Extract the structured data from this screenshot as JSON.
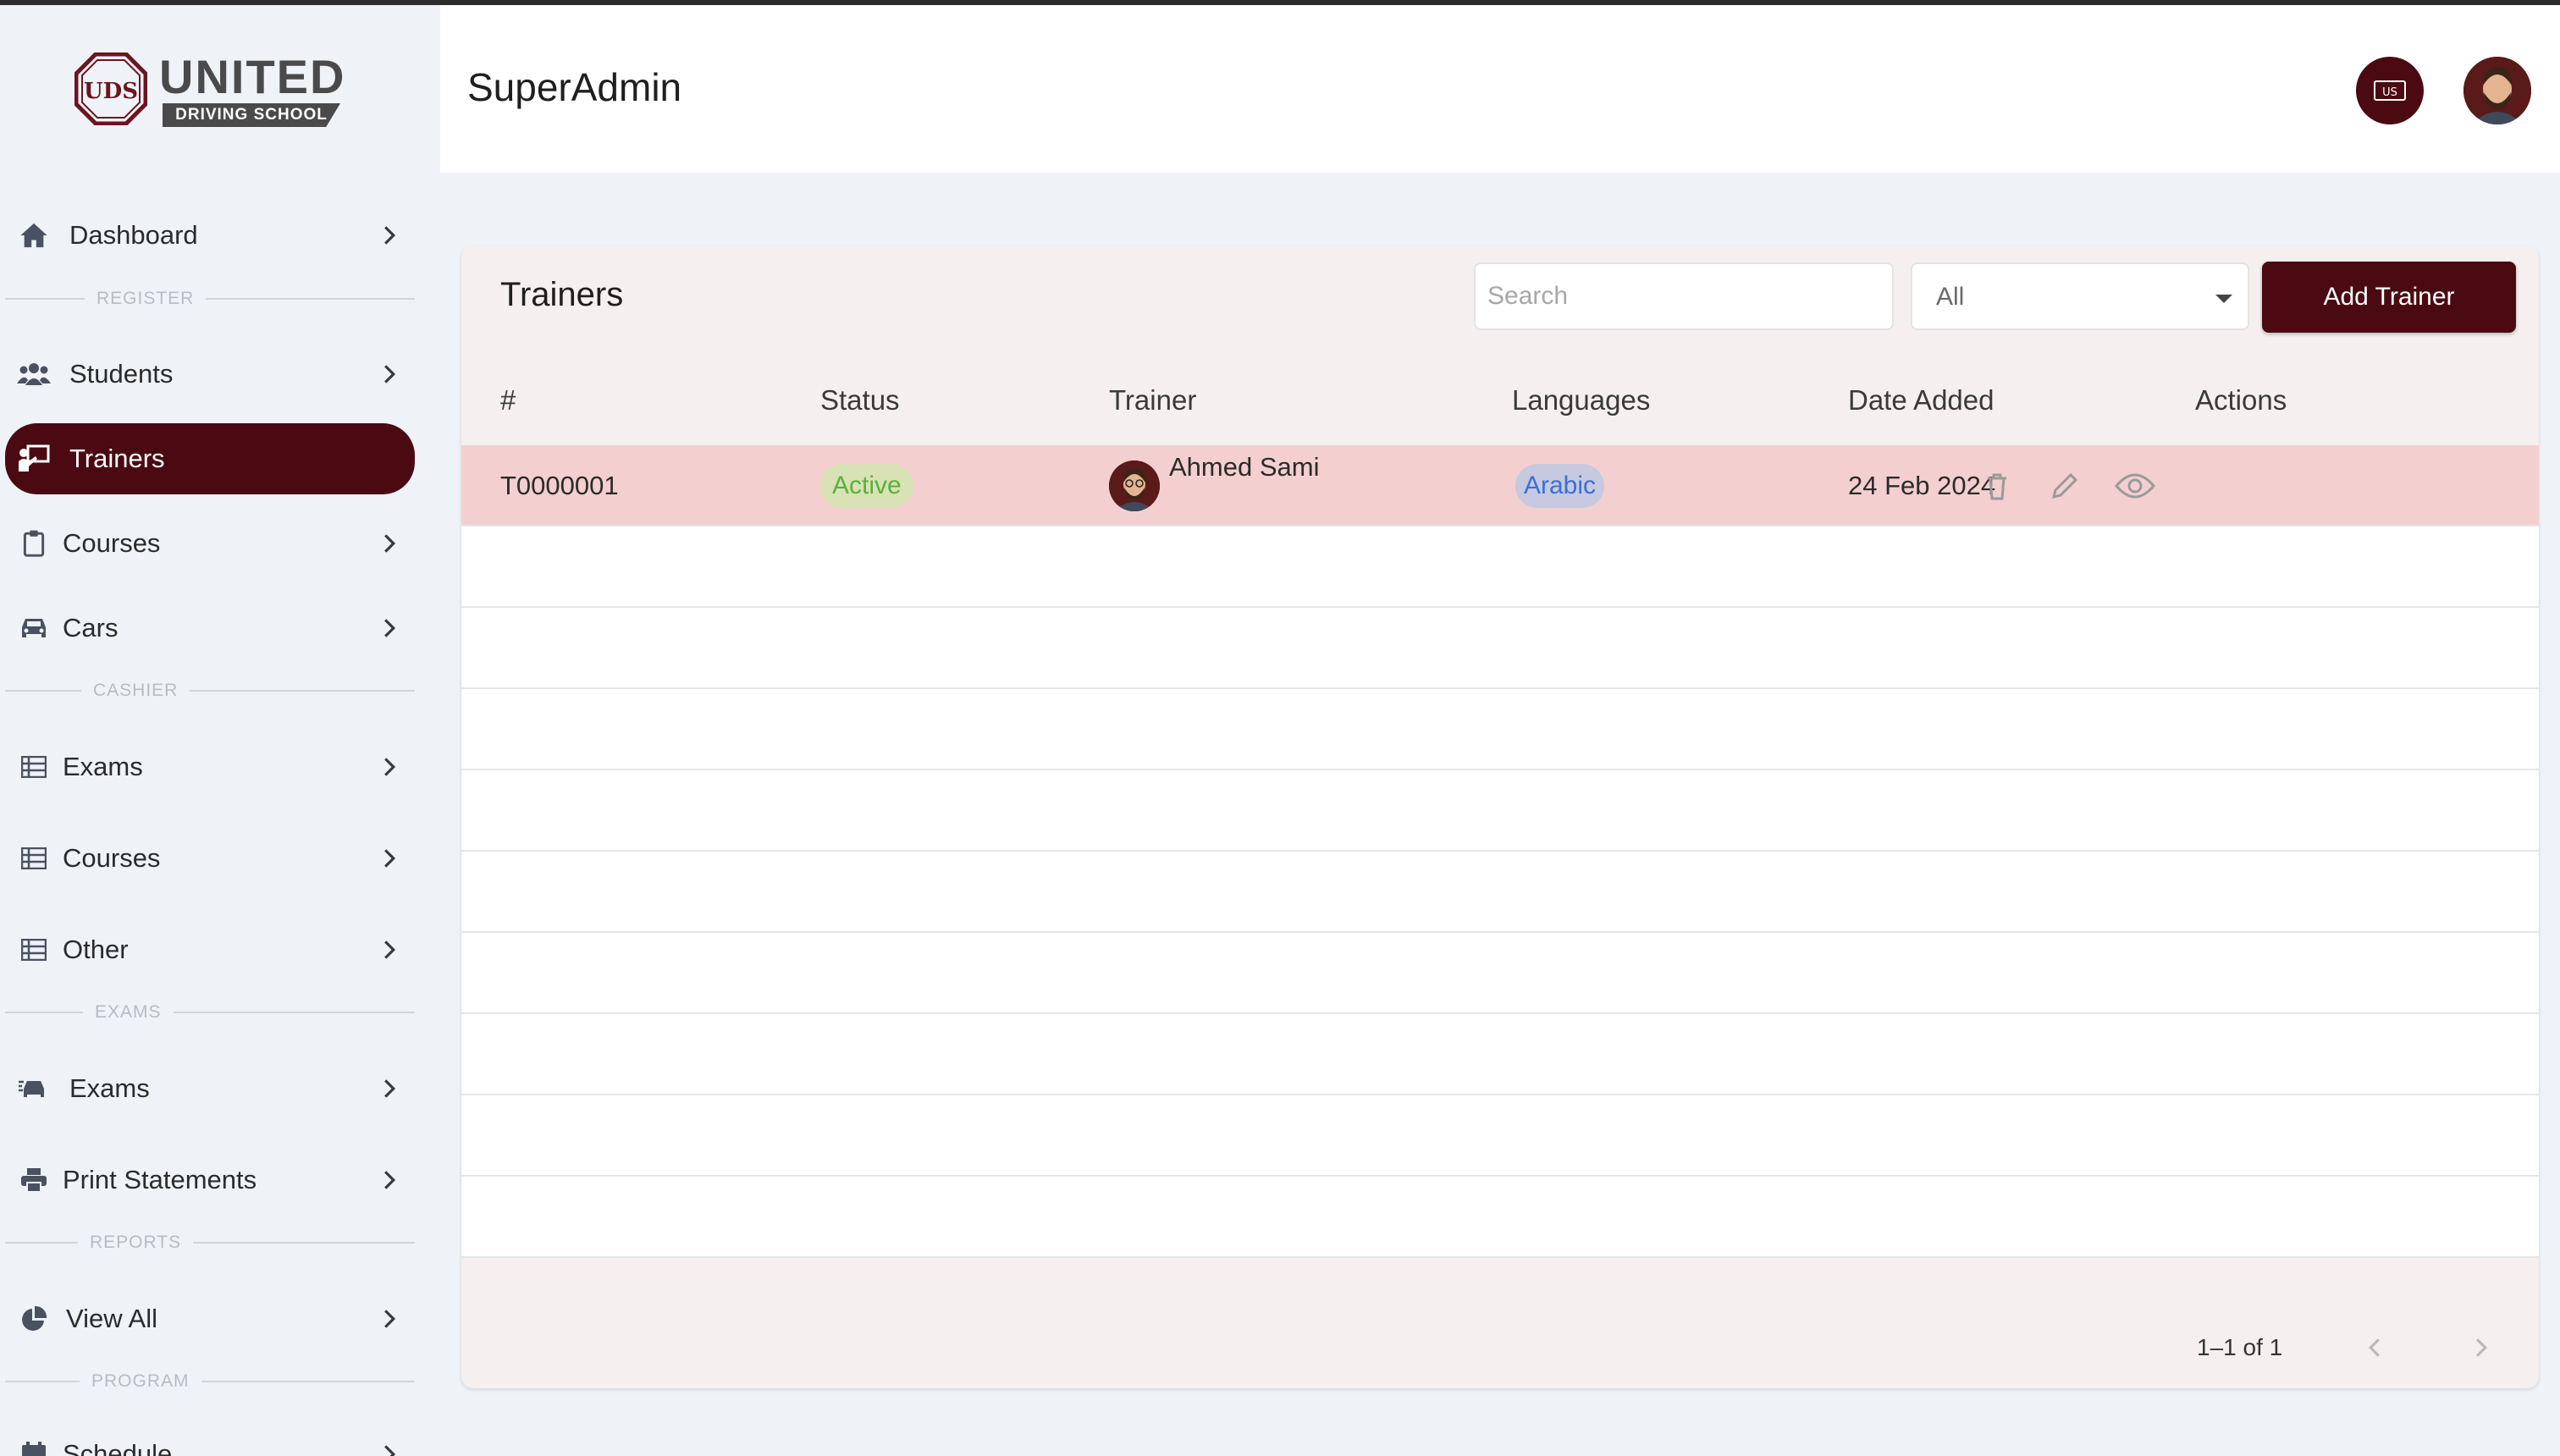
{
  "brand": {
    "name": "UNITED",
    "subtitle": "DRIVING SCHOOL",
    "mark": "UDS"
  },
  "header": {
    "title": "SuperAdmin",
    "language_button": "US"
  },
  "sidebar": {
    "items": [
      {
        "label": "Dashboard",
        "icon": "home-icon"
      },
      {
        "section": "REGISTER"
      },
      {
        "label": "Students",
        "icon": "users-icon"
      },
      {
        "label": "Trainers",
        "icon": "trainer-icon",
        "active": true
      },
      {
        "label": "Courses",
        "icon": "clipboard-icon"
      },
      {
        "label": "Cars",
        "icon": "car-icon"
      },
      {
        "section": "CASHIER"
      },
      {
        "label": "Exams",
        "icon": "table-icon"
      },
      {
        "label": "Courses",
        "icon": "table-icon"
      },
      {
        "label": "Other",
        "icon": "table-icon"
      },
      {
        "section": "EXAMS"
      },
      {
        "label": "Exams",
        "icon": "car-exam-icon"
      },
      {
        "label": "Print Statements",
        "icon": "printer-icon"
      },
      {
        "section": "REPORTS"
      },
      {
        "label": "View All",
        "icon": "pie-chart-icon"
      },
      {
        "section": "PROGRAM"
      },
      {
        "label": "Schedule",
        "icon": "calendar-icon"
      }
    ]
  },
  "trainers": {
    "title": "Trainers",
    "search_placeholder": "Search",
    "filter_value": "All",
    "add_button": "Add Trainer",
    "columns": [
      "#",
      "Status",
      "Trainer",
      "Languages",
      "Date Added",
      "Actions"
    ],
    "rows": [
      {
        "id": "T0000001",
        "status": "Active",
        "trainer": "Ahmed Sami",
        "language": "Arabic",
        "date_added": "24 Feb 2024"
      }
    ],
    "pagination": "1–1 of 1"
  },
  "colors": {
    "primary": "#4b0a12",
    "active_text": "#58b23a",
    "language_text": "#3b6fd4",
    "row_highlight": "#f4cfcf"
  }
}
